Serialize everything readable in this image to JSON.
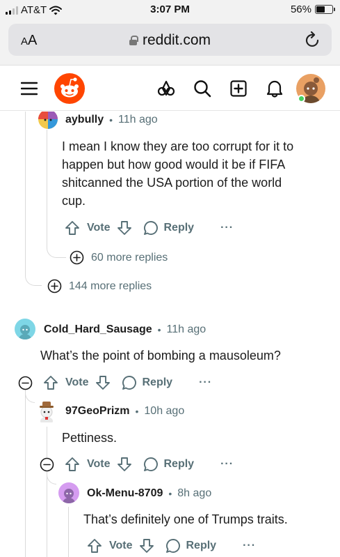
{
  "status_bar": {
    "carrier": "AT&T",
    "time": "3:07 PM",
    "battery": "56%",
    "battery_level": 0.56
  },
  "browser": {
    "text_size_label_big": "A",
    "text_size_label_small": "A",
    "url": "reddit.com"
  },
  "comments": [
    {
      "id": "c1",
      "username": "aybully",
      "time": "11h ago",
      "body_lines": [
        "I mean I know they are too corrupt for it to",
        "happen but how good would it be if FIFA",
        "shitcanned the USA portion of the world",
        "cup."
      ],
      "vote_label": "Vote",
      "reply_label": "Reply",
      "more_icon": "···",
      "more_replies": "60 more replies"
    },
    {
      "id": "parent_more",
      "more_replies": "144 more replies"
    },
    {
      "id": "c2",
      "username": "Cold_Hard_Sausage",
      "time": "11h ago",
      "body": "What’s the point of bombing a mausoleum?",
      "vote_label": "Vote",
      "reply_label": "Reply",
      "more_icon": "···"
    },
    {
      "id": "c3",
      "username": "97GeoPrizm",
      "time": "10h ago",
      "body": "Pettiness.",
      "vote_label": "Vote",
      "reply_label": "Reply",
      "more_icon": "···"
    },
    {
      "id": "c4",
      "username": "Ok-Menu-8709",
      "time": "8h ago",
      "body": "That’s definitely one of Trumps traits.",
      "vote_label": "Vote",
      "reply_label": "Reply",
      "more_icon": "···"
    }
  ],
  "colors": {
    "reddit_orange": "#ff4500",
    "meta_gray": "#576f76",
    "thread_line": "#dadada",
    "online_green": "#46d160"
  }
}
